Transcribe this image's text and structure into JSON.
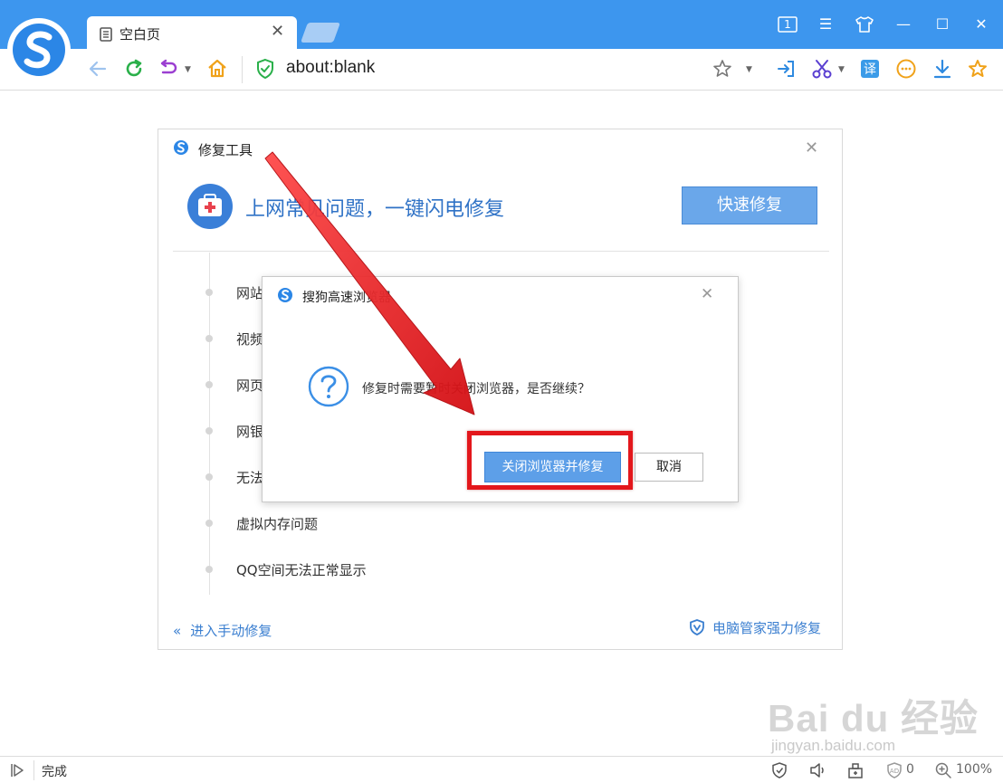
{
  "browser": {
    "tab_title": "空白页",
    "tab_count": "1",
    "address": "about:blank"
  },
  "repair_tool": {
    "title": "修复工具",
    "headline": "上网常见问题，一键闪电修复",
    "quick_fix_button": "快速修复",
    "issues": [
      "网站",
      "视频",
      "网页",
      "网银",
      "无法",
      "虚拟内存问题",
      "QQ空间无法正常显示"
    ],
    "manual_link": "进入手动修复",
    "guard_link": "电脑管家强力修复"
  },
  "dialog": {
    "title": "搜狗高速浏览器",
    "message": "修复时需要暂时关闭浏览器，是否继续？",
    "confirm_button": "关闭浏览器并修复",
    "cancel_button": "取消"
  },
  "status_bar": {
    "status": "完成",
    "blocked_count": "0",
    "zoom": "100%"
  },
  "watermark": {
    "main": "Bai du 经验",
    "sub": "jingyan.baidu.com"
  },
  "colors": {
    "titlebar": "#3d96ee",
    "accent_blue": "#2f72c6",
    "highlight_red": "#e3171c"
  }
}
